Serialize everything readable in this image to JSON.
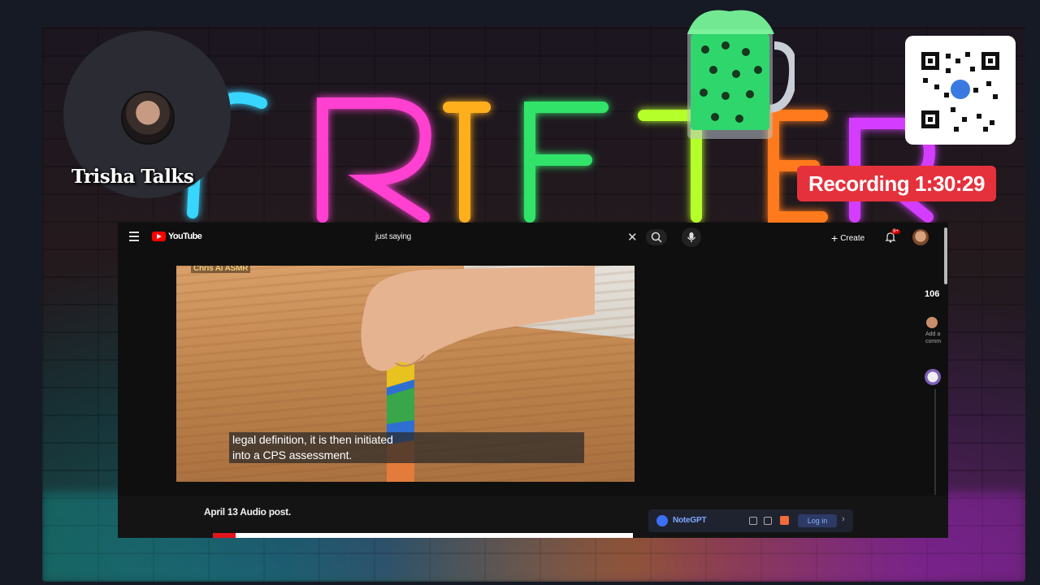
{
  "overlay": {
    "streamer_name": "Trisha Talks",
    "recording_label": "Recording 1:30:29",
    "neon_sign_text": "GRIFTER",
    "recording_color": "#e5313c"
  },
  "browser": {
    "site_logo_word": "YouTube",
    "search_query": "just saying",
    "create_label": "Create",
    "notifications_badge": "9+",
    "icons": [
      "menu-icon",
      "youtube-logo-icon",
      "clear-icon",
      "search-icon",
      "mic-icon",
      "plus-icon",
      "bell-icon"
    ]
  },
  "video": {
    "channel_tag": "Chris Ai ASMR",
    "caption_line1": "legal definition, it is then initiated",
    "caption_line2": "into a CPS assessment.",
    "post_title": "April 13 Audio post.",
    "progress_fraction": 0.055
  },
  "side_panel": {
    "count": "106",
    "add_comment": "Add a comm"
  },
  "notegpt": {
    "name": "NoteGPT",
    "login_label": "Log in",
    "accent": "#3b6ff5"
  }
}
